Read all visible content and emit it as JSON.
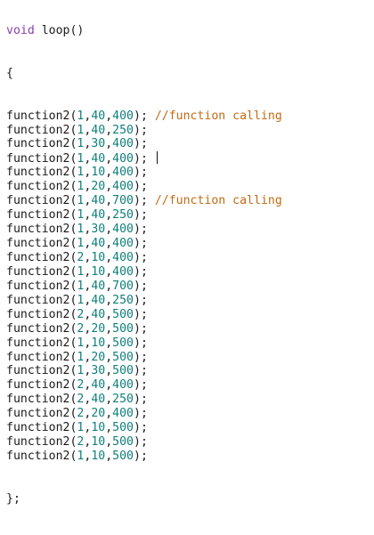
{
  "colors": {
    "keyword": "#8a3fb0",
    "number": "#0f7f7a",
    "comment": "#c26a14",
    "text": "#1a1a1a",
    "background": "#ffffff"
  },
  "header": {
    "keyword": "void",
    "signature": " loop()"
  },
  "open_brace": "{",
  "close_brace": "};",
  "calls": [
    {
      "fn": "function2",
      "a": "1",
      "b": "40",
      "c": "400",
      "comment": "//function calling"
    },
    {
      "fn": "function2",
      "a": "1",
      "b": "40",
      "c": "250"
    },
    {
      "fn": "function2",
      "a": "1",
      "b": "30",
      "c": "400"
    },
    {
      "fn": "function2",
      "a": "1",
      "b": "40",
      "c": "400",
      "caret": true
    },
    {
      "fn": "function2",
      "a": "1",
      "b": "10",
      "c": "400"
    },
    {
      "fn": "function2",
      "a": "1",
      "b": "20",
      "c": "400"
    },
    {
      "fn": "function2",
      "a": "1",
      "b": "40",
      "c": "700",
      "comment": "//function calling"
    },
    {
      "fn": "function2",
      "a": "1",
      "b": "40",
      "c": "250"
    },
    {
      "fn": "function2",
      "a": "1",
      "b": "30",
      "c": "400"
    },
    {
      "fn": "function2",
      "a": "1",
      "b": "40",
      "c": "400"
    },
    {
      "fn": "function2",
      "a": "2",
      "b": "10",
      "c": "400"
    },
    {
      "fn": "function2",
      "a": "1",
      "b": "10",
      "c": "400"
    },
    {
      "fn": "function2",
      "a": "1",
      "b": "40",
      "c": "700"
    },
    {
      "fn": "function2",
      "a": "1",
      "b": "40",
      "c": "250"
    },
    {
      "fn": "function2",
      "a": "2",
      "b": "40",
      "c": "500"
    },
    {
      "fn": "function2",
      "a": "2",
      "b": "20",
      "c": "500"
    },
    {
      "fn": "function2",
      "a": "1",
      "b": "10",
      "c": "500"
    },
    {
      "fn": "function2",
      "a": "1",
      "b": "20",
      "c": "500"
    },
    {
      "fn": "function2",
      "a": "1",
      "b": "30",
      "c": "500"
    },
    {
      "fn": "function2",
      "a": "2",
      "b": "40",
      "c": "400"
    },
    {
      "fn": "function2",
      "a": "2",
      "b": "40",
      "c": "250"
    },
    {
      "fn": "function2",
      "a": "2",
      "b": "20",
      "c": "400"
    },
    {
      "fn": "function2",
      "a": "1",
      "b": "10",
      "c": "500"
    },
    {
      "fn": "function2",
      "a": "2",
      "b": "10",
      "c": "500"
    },
    {
      "fn": "function2",
      "a": "1",
      "b": "10",
      "c": "500"
    }
  ]
}
